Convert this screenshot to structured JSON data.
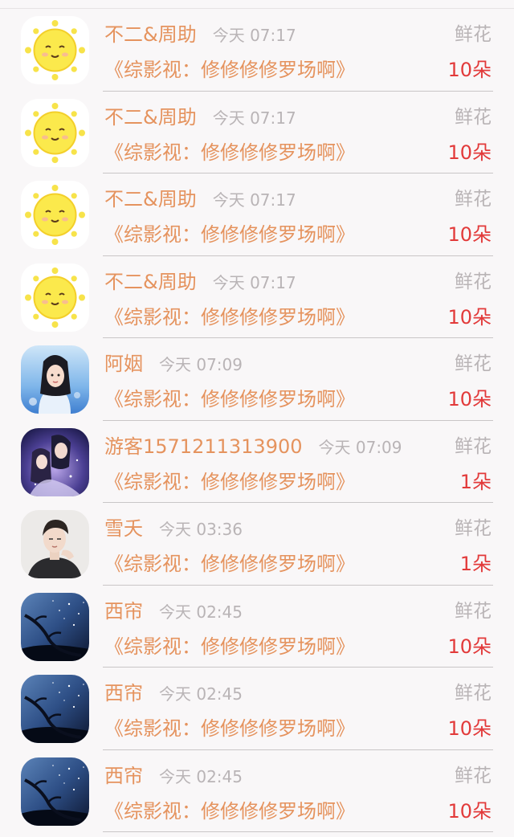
{
  "items": [
    {
      "name": "不二&周助",
      "time": "今天 07:17",
      "gift": "鲜花",
      "book": "《综影视：修修修修罗场啊》",
      "count": "10朵",
      "avatar": "sun-avatar"
    },
    {
      "name": "不二&周助",
      "time": "今天 07:17",
      "gift": "鲜花",
      "book": "《综影视：修修修修罗场啊》",
      "count": "10朵",
      "avatar": "sun-avatar"
    },
    {
      "name": "不二&周助",
      "time": "今天 07:17",
      "gift": "鲜花",
      "book": "《综影视：修修修修罗场啊》",
      "count": "10朵",
      "avatar": "sun-avatar"
    },
    {
      "name": "不二&周助",
      "time": "今天 07:17",
      "gift": "鲜花",
      "book": "《综影视：修修修修罗场啊》",
      "count": "10朵",
      "avatar": "sun-avatar"
    },
    {
      "name": "阿姻",
      "time": "今天 07:09",
      "gift": "鲜花",
      "book": "《综影视：修修修修罗场啊》",
      "count": "10朵",
      "avatar": "girl-avatar"
    },
    {
      "name": "游客1571211313900",
      "time": "今天 07:09",
      "gift": "鲜花",
      "book": "《综影视：修修修修罗场啊》",
      "count": "1朵",
      "avatar": "couple-avatar"
    },
    {
      "name": "雪夭",
      "time": "今天 03:36",
      "gift": "鲜花",
      "book": "《综影视：修修修修罗场啊》",
      "count": "1朵",
      "avatar": "man-avatar"
    },
    {
      "name": "西帘",
      "time": "今天 02:45",
      "gift": "鲜花",
      "book": "《综影视：修修修修罗场啊》",
      "count": "10朵",
      "avatar": "night-sky-avatar"
    },
    {
      "name": "西帘",
      "time": "今天 02:45",
      "gift": "鲜花",
      "book": "《综影视：修修修修罗场啊》",
      "count": "10朵",
      "avatar": "night-sky-avatar"
    },
    {
      "name": "西帘",
      "time": "今天 02:45",
      "gift": "鲜花",
      "book": "《综影视：修修修修罗场啊》",
      "count": "10朵",
      "avatar": "night-sky-avatar"
    }
  ],
  "colors": {
    "name": "#e5935e",
    "book": "#e5935e",
    "time": "#b9b4b6",
    "gift": "#b9b4b6",
    "count": "#e23a3a",
    "background": "#f9f7f8"
  }
}
